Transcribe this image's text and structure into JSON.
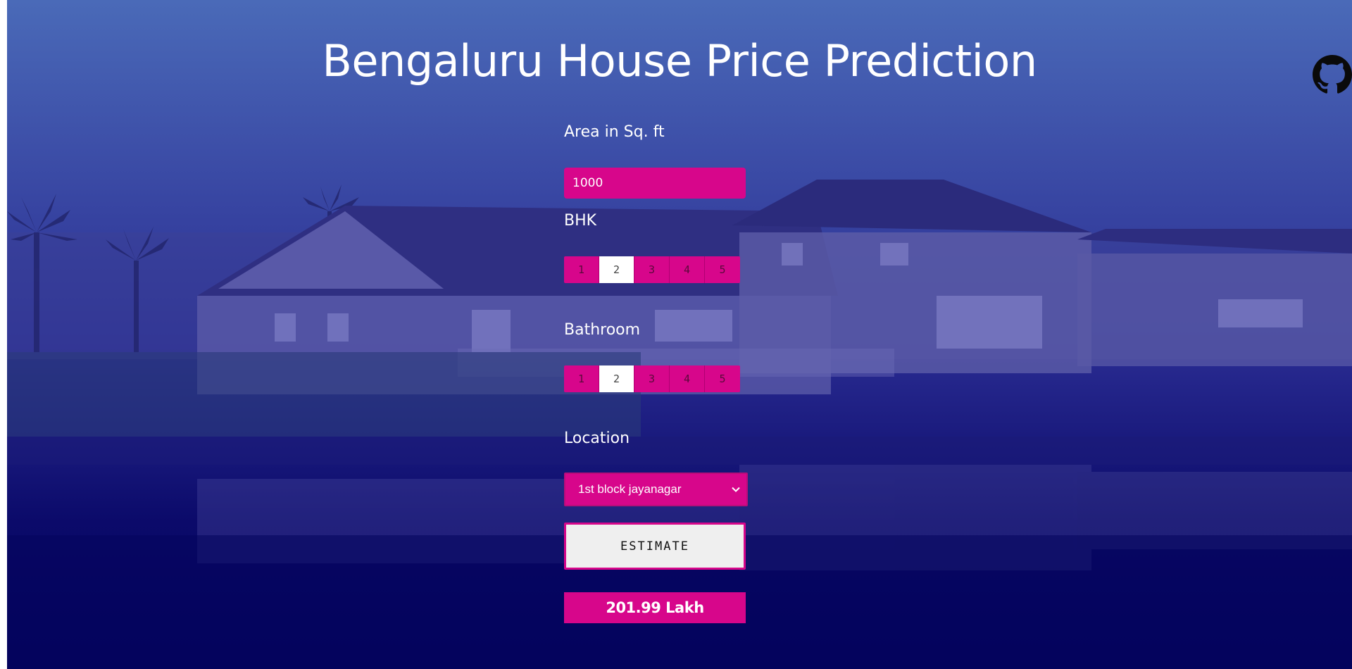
{
  "page": {
    "title": "Bengaluru House Price Prediction"
  },
  "form": {
    "area_label": "Area in Sq. ft",
    "area_value": "1000",
    "bhk_label": "BHK",
    "bhk_options": [
      "1",
      "2",
      "3",
      "4",
      "5"
    ],
    "bhk_selected": "2",
    "bath_label": "Bathroom",
    "bath_options": [
      "1",
      "2",
      "3",
      "4",
      "5"
    ],
    "bath_selected": "2",
    "location_label": "Location",
    "location_value": "1st block jayanagar",
    "estimate_label": "ESTIMATE",
    "result": "201.99 Lakh"
  },
  "icons": {
    "github": "github-icon",
    "dropdown": "chevron-down-icon"
  },
  "colors": {
    "accent": "#d7068b",
    "background_top": "#4a6ab8",
    "background_bottom": "#04035c",
    "selected": "#ffffff"
  }
}
